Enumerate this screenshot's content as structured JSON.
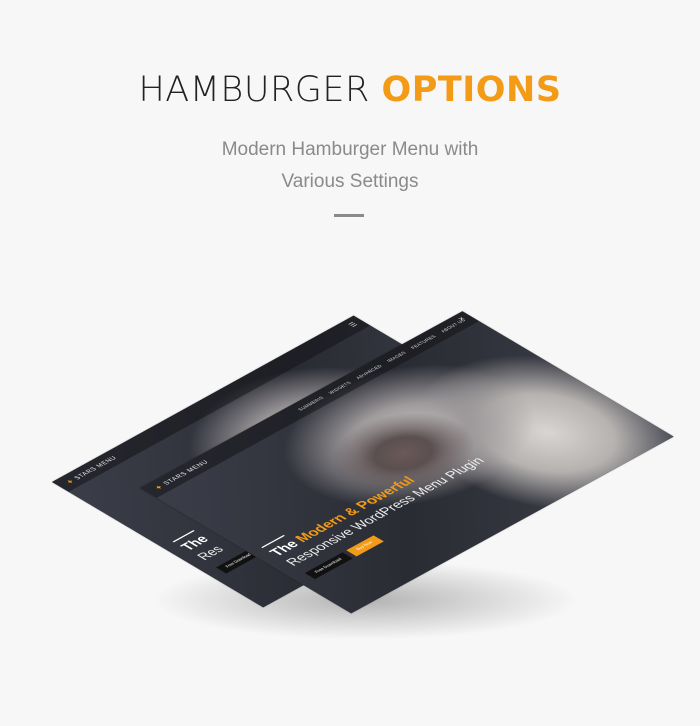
{
  "heading": {
    "part1": "HAMBURGER ",
    "part2": "OPTIONS"
  },
  "subtitle": {
    "line1": "Modern Hamburger Menu with",
    "line2": "Various Settings"
  },
  "mockup": {
    "logo_text": "STARS MENU",
    "menu_items": [
      "SUMMERIS",
      "WIDGETS",
      "ADVANCED",
      "IMAGES",
      "FEATURES",
      "ABOUT US"
    ],
    "hero_title_white": "The ",
    "hero_title_accent": "Modern & Powerful",
    "hero_subtitle": "Responsive WordPress Menu Plugin",
    "back_hero_title": "The",
    "back_hero_sub": "Res",
    "button_primary": "Free Download",
    "button_secondary": "Buy Now",
    "hamburger_glyph": "☰",
    "close_glyph": "✕"
  },
  "colors": {
    "accent": "#f39a16",
    "text_dark": "#222222",
    "text_muted": "#8a8a8a"
  }
}
